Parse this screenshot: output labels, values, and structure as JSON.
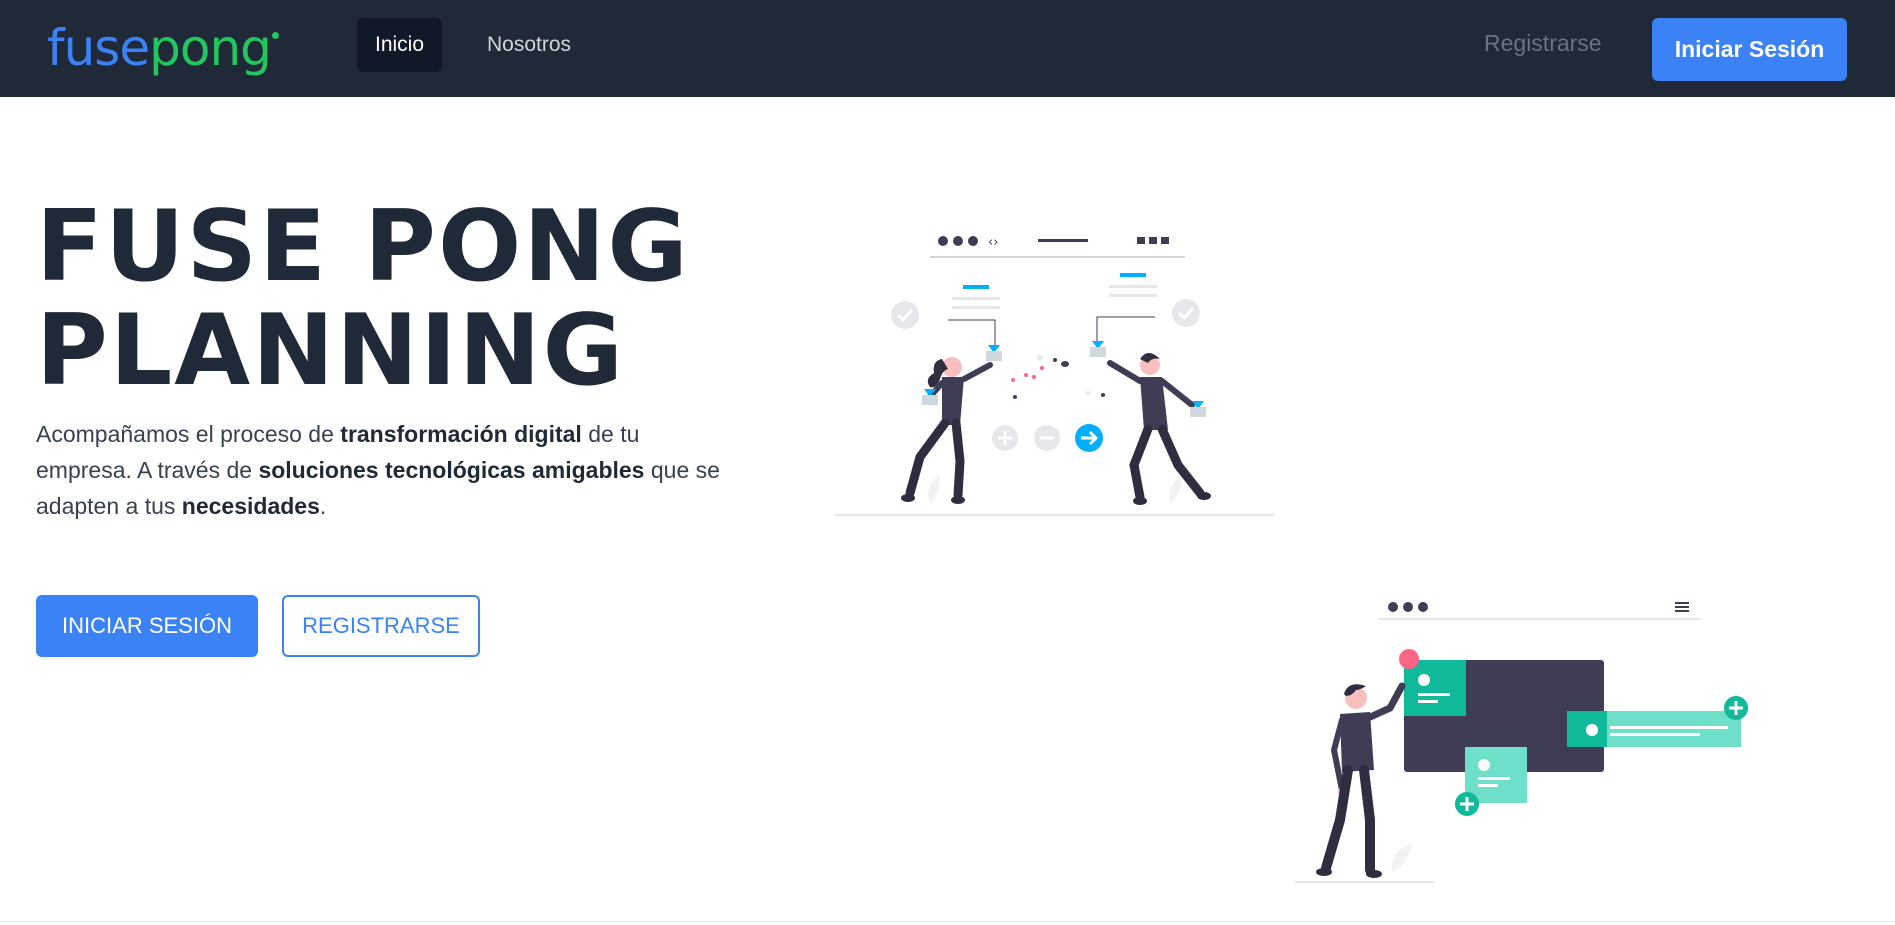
{
  "brand": {
    "fuse": "fuse",
    "pong": "pong"
  },
  "nav": {
    "items": [
      {
        "label": "Inicio",
        "active": true
      },
      {
        "label": "Nosotros",
        "active": false
      }
    ],
    "register_label": "Registrarse",
    "login_label": "Iniciar Sesión"
  },
  "hero": {
    "title_line1": "FUSE PONG",
    "title_line2": "PLANNING",
    "desc": {
      "p1": "Acompañamos el proceso de ",
      "b1": "transformación digital",
      "p2": " de tu empresa. A través de ",
      "b2": "soluciones tecnológicas amigables",
      "p3": " que se adapten a tus ",
      "b3": "necesidades",
      "p4": "."
    },
    "login_button": "INICIAR SESIÓN",
    "register_button": "REGISTRARSE"
  },
  "colors": {
    "navbar_bg": "#1f2937",
    "primary": "#3b82f6",
    "brand_green": "#22c55e",
    "teal": "#10b99a",
    "illustration_dark": "#3f3d56"
  }
}
